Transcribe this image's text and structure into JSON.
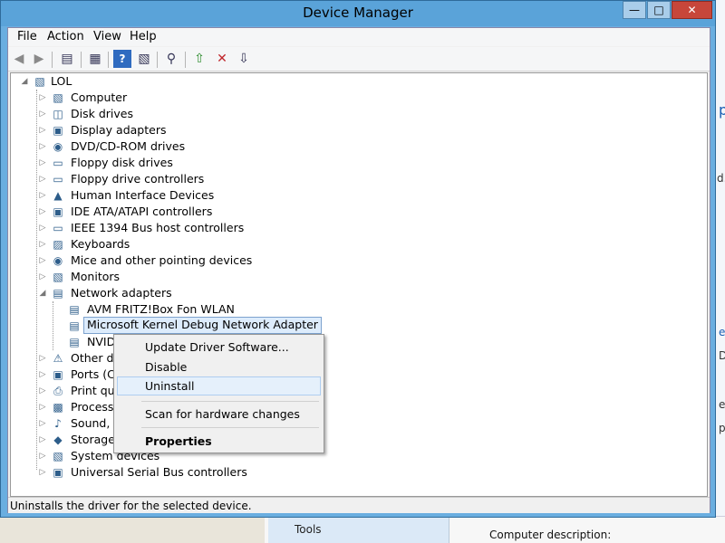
{
  "window": {
    "title": "Device Manager",
    "min_glyph": "—",
    "max_glyph": "□",
    "close_glyph": "✕"
  },
  "menubar": {
    "items": [
      "File",
      "Action",
      "View",
      "Help"
    ]
  },
  "toolbar": {
    "buttons": [
      "back-icon",
      "forward-icon",
      "show-hide-console-tree-icon",
      "properties-icon",
      "help-icon",
      "show-action-pane-icon",
      "scan-hardware-icon",
      "update-driver-icon",
      "uninstall-icon",
      "disable-icon"
    ]
  },
  "tree": {
    "root": "LOL",
    "categories": [
      "Computer",
      "Disk drives",
      "Display adapters",
      "DVD/CD-ROM drives",
      "Floppy disk drives",
      "Floppy drive controllers",
      "Human Interface Devices",
      "IDE ATA/ATAPI controllers",
      "IEEE 1394 Bus host controllers",
      "Keyboards",
      "Mice and other pointing devices",
      "Monitors",
      "Network adapters"
    ],
    "network_children": [
      "AVM FRITZ!Box Fon WLAN",
      "Microsoft Kernel Debug Network Adapter",
      "NVIDIA"
    ],
    "categories_after": [
      "Other devi",
      "Ports (CON",
      "Print queue",
      "Processors",
      "Sound, vid",
      "Storage co",
      "System devices",
      "Universal Serial Bus controllers"
    ],
    "selected_item": "Microsoft Kernel Debug Network Adapter"
  },
  "context_menu": {
    "items": [
      "Update Driver Software...",
      "Disable",
      "Uninstall",
      "Scan for hardware changes",
      "Properties"
    ],
    "hovered": "Uninstall"
  },
  "statusbar": {
    "text": "Uninstalls the driver for the selected device."
  },
  "background": {
    "tools_label": "Tools",
    "computer_description_label": "Computer description:",
    "fragments": [
      "p",
      "d.",
      "e",
      "D",
      "e",
      "p"
    ]
  }
}
